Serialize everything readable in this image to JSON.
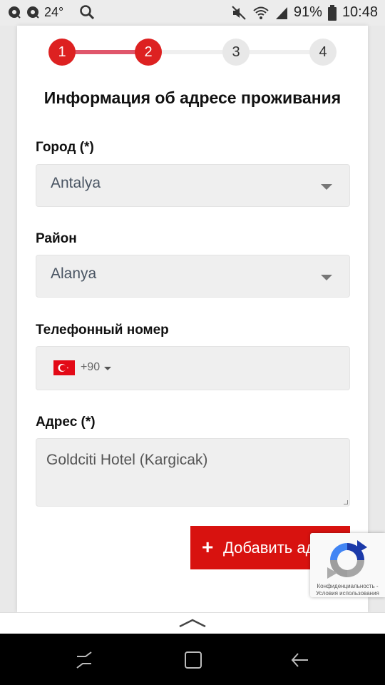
{
  "status_bar": {
    "temperature": "24°",
    "battery": "91%",
    "time": "10:48",
    "icons": [
      "sync-icon",
      "sync-icon",
      "search-icon",
      "mute-icon",
      "wifi-icon",
      "signal-icon",
      "battery-icon"
    ]
  },
  "steps": {
    "items": [
      {
        "label": "1",
        "state": "active"
      },
      {
        "label": "2",
        "state": "active"
      },
      {
        "label": "3",
        "state": "inactive"
      },
      {
        "label": "4",
        "state": "inactive"
      }
    ],
    "active_color": "#dd2121",
    "line_done_color": "#e0566b"
  },
  "form": {
    "title": "Информация об адресе проживания",
    "city_label": "Город (*)",
    "city_value": "Antalya",
    "district_label": "Район",
    "district_value": "Alanya",
    "phone_label": "Телефонный номер",
    "phone_code": "+90",
    "address_label": "Адрес (*)",
    "address_value": "Goldciti Hotel (Kargicak)",
    "add_button_label": "Добавить адрес"
  },
  "recaptcha": {
    "legal_text": "Конфиденциальность - Условия использования"
  },
  "navbar": {
    "icons": [
      "recent-apps-icon",
      "home-icon",
      "back-icon"
    ]
  }
}
